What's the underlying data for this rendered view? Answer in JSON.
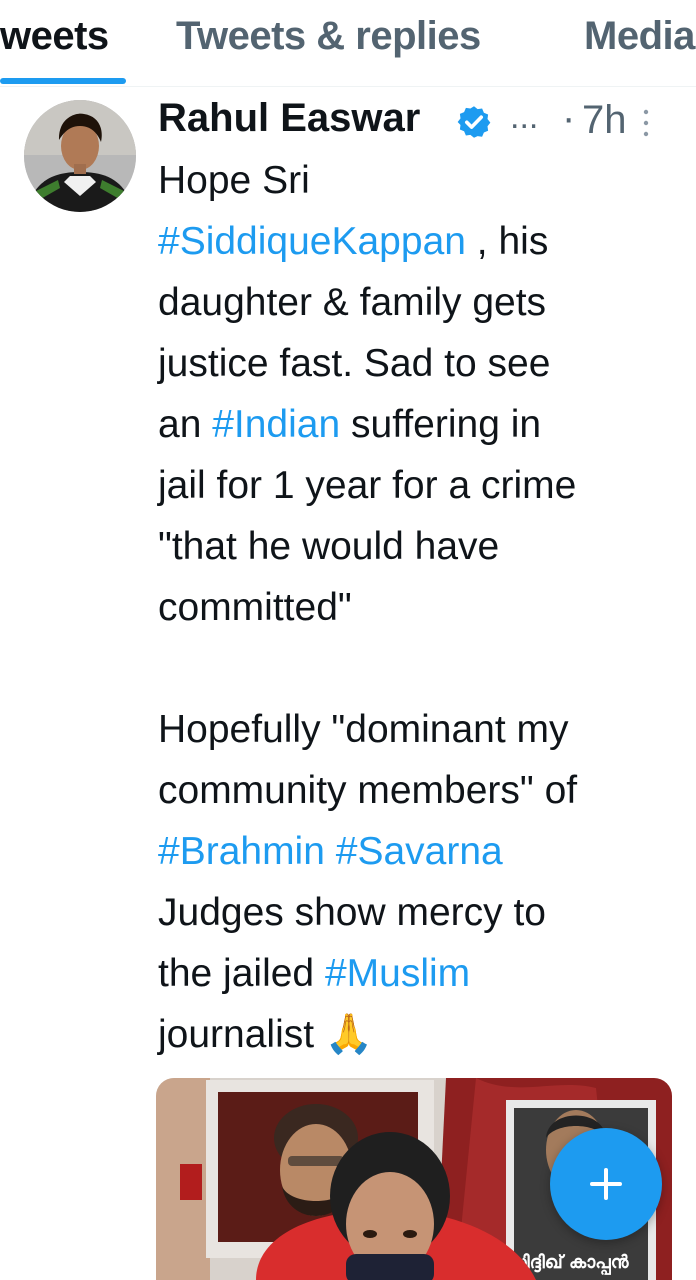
{
  "tabs": [
    {
      "label": "weets",
      "active": true
    },
    {
      "label": "Tweets & replies",
      "active": false
    },
    {
      "label": "Media",
      "active": false
    }
  ],
  "tweet": {
    "author_name": "Rahul Easwar",
    "verified": true,
    "handle_truncated": "...",
    "separator": "·",
    "time": "7h",
    "lines": [
      [
        {
          "t": "Hope Sri"
        }
      ],
      [
        {
          "t": "#SiddiqueKappan",
          "tag": true
        },
        {
          "t": " , his"
        }
      ],
      [
        {
          "t": "daughter & family gets"
        }
      ],
      [
        {
          "t": "justice fast. Sad to see"
        }
      ],
      [
        {
          "t": "an "
        },
        {
          "t": "#Indian",
          "tag": true
        },
        {
          "t": " suffering in"
        }
      ],
      [
        {
          "t": "jail for 1 year for a crime"
        }
      ],
      [
        {
          "t": "\"that he would have"
        }
      ],
      [
        {
          "t": "committed\""
        }
      ],
      [],
      [
        {
          "t": "Hopefully \"dominant my"
        }
      ],
      [
        {
          "t": "community members\" of"
        }
      ],
      [
        {
          "t": "#Brahmin",
          "tag": true
        },
        {
          "t": " "
        },
        {
          "t": "#Savarna",
          "tag": true
        }
      ],
      [
        {
          "t": "Judges show mercy to"
        }
      ],
      [
        {
          "t": "the jailed "
        },
        {
          "t": "#Muslim",
          "tag": true
        }
      ],
      [
        {
          "t": "journalist "
        },
        {
          "t": "🙏",
          "emoji": true
        }
      ]
    ],
    "media_sign_text": "സിദ്ദിഖ് കാപ്പൻ"
  },
  "colors": {
    "accent": "#1d9bf0",
    "text_primary": "#0f1419",
    "text_secondary": "#536471"
  },
  "icons": {
    "verified": "verified-badge-icon",
    "more": "more-vertical-icon",
    "compose": "plus-icon"
  }
}
